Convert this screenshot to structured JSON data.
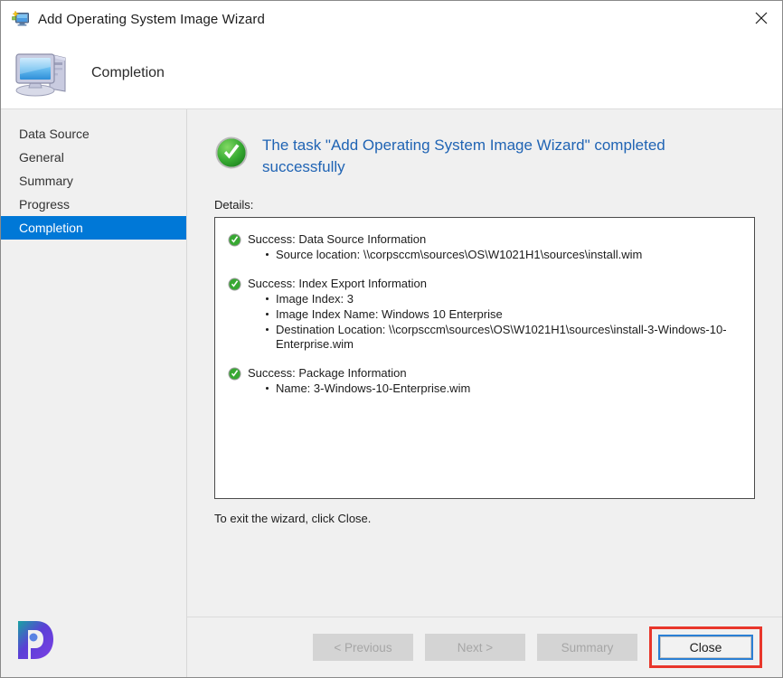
{
  "window": {
    "title": "Add Operating System Image Wizard",
    "icon": "wizard-monitor-icon",
    "close_label": "✕"
  },
  "header": {
    "title": "Completion",
    "icon": "computer-monitor-icon"
  },
  "sidebar": {
    "items": [
      {
        "label": "Data Source",
        "selected": false
      },
      {
        "label": "General",
        "selected": false
      },
      {
        "label": "Summary",
        "selected": false
      },
      {
        "label": "Progress",
        "selected": false
      },
      {
        "label": "Completion",
        "selected": true
      }
    ]
  },
  "content": {
    "success_message": "The task \"Add Operating System Image Wizard\" completed successfully",
    "success_icon": "green-check-circle-icon",
    "details_label": "Details:",
    "exit_note": "To exit the wizard, click Close.",
    "detail_groups": [
      {
        "icon": "green-check-small-icon",
        "heading": "Success: Data Source Information",
        "bullets": [
          "Source location: \\\\corpsccm\\sources\\OS\\W1021H1\\sources\\install.wim"
        ]
      },
      {
        "icon": "green-check-small-icon",
        "heading": "Success: Index Export Information",
        "bullets": [
          "Image Index: 3",
          "Image Index Name: Windows 10 Enterprise",
          "Destination Location: \\\\corpsccm\\sources\\OS\\W1021H1\\sources\\install-3-Windows-10-Enterprise.wim"
        ]
      },
      {
        "icon": "green-check-small-icon",
        "heading": "Success: Package Information",
        "bullets": [
          "Name: 3-Windows-10-Enterprise.wim"
        ]
      }
    ]
  },
  "footer": {
    "previous_label": "< Previous",
    "next_label": "Next >",
    "summary_label": "Summary",
    "close_label": "Close"
  },
  "colors": {
    "accent_selected": "#0078d7",
    "link_blue": "#2064b4",
    "success_green": "#3aa23a",
    "highlight_red": "#e8362b",
    "focus_blue": "#2a7fd4"
  }
}
